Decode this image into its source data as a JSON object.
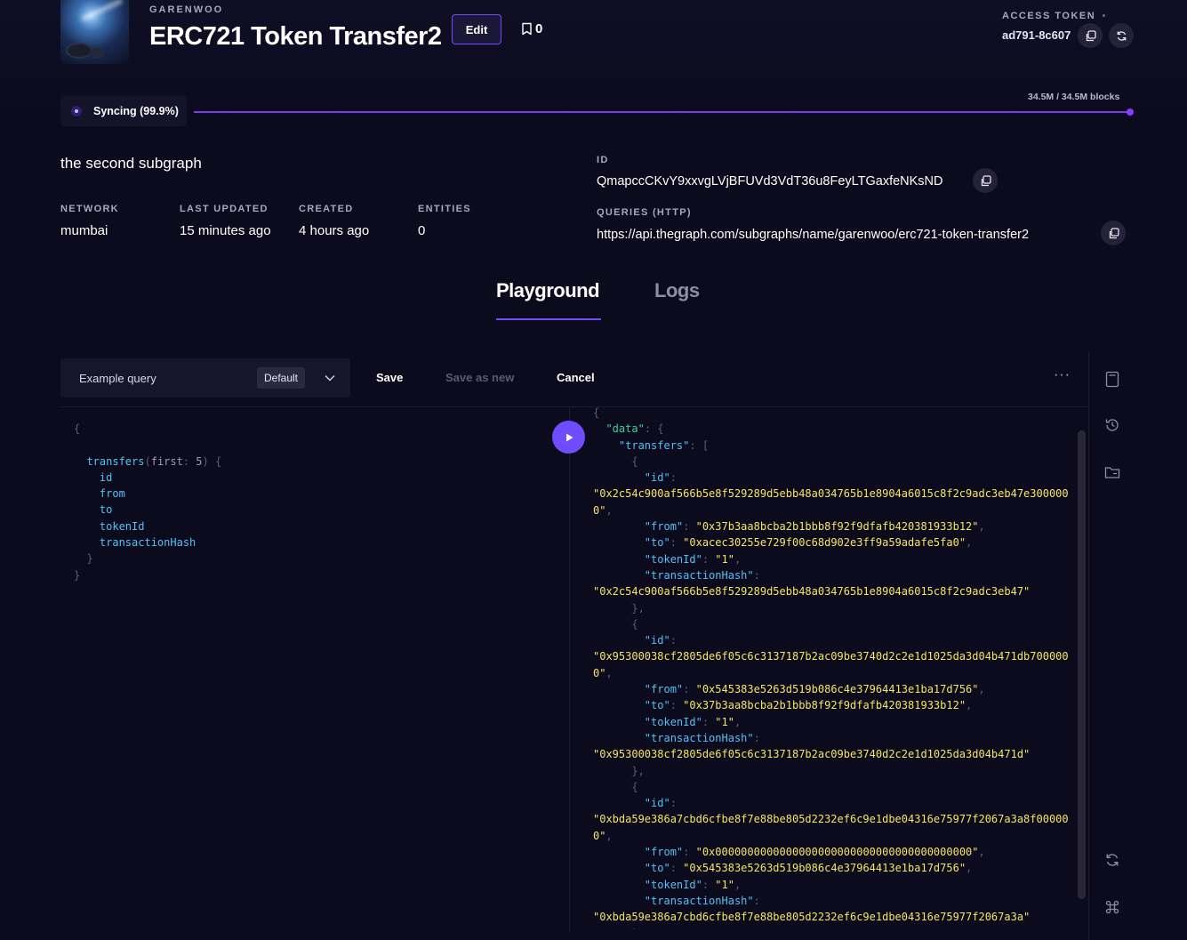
{
  "header": {
    "owner": "GARENWOO",
    "title": "ERC721 Token Transfer2",
    "edit_label": "Edit",
    "bookmark_count": "0",
    "access_token_label": "ACCESS TOKEN",
    "access_token_value": "ad791-8c607"
  },
  "sync": {
    "status": "Syncing (99.9%)",
    "progress_percent": 99.9,
    "blocks": "34.5M / 34.5M blocks",
    "accent": "#7c3aed"
  },
  "details": {
    "description": "the second subgraph",
    "meta": [
      {
        "label": "NETWORK",
        "value": "mumbai"
      },
      {
        "label": "LAST UPDATED",
        "value": "15 minutes ago"
      },
      {
        "label": "CREATED",
        "value": "4 hours ago"
      },
      {
        "label": "ENTITIES",
        "value": "0"
      }
    ],
    "id_label": "ID",
    "id_value": "QmapccCKvY9xxvgLVjBFUVd3VdT36u8FeyLTGaxfeNKsND",
    "queries_label": "QUERIES (HTTP)",
    "queries_value": "https://api.thegraph.com/subgraphs/name/garenwoo/erc721-token-transfer2"
  },
  "tabs": [
    {
      "label": "Playground",
      "active": true
    },
    {
      "label": "Logs",
      "active": false
    }
  ],
  "playground": {
    "query_name": "Example query",
    "default_badge": "Default",
    "save_label": "Save",
    "save_as_new_label": "Save as new",
    "cancel_label": "Cancel",
    "more_label": "···",
    "query_lines": [
      {
        "indent": 0,
        "text": "{",
        "kind": "p"
      },
      {
        "indent": 0,
        "text": "",
        "kind": "p"
      },
      {
        "indent": 1,
        "text": "transfers",
        "kind": "k",
        "suffix_args": "(first: 5) {"
      },
      {
        "indent": 2,
        "text": "id",
        "kind": "k"
      },
      {
        "indent": 2,
        "text": "from",
        "kind": "k"
      },
      {
        "indent": 2,
        "text": "to",
        "kind": "k"
      },
      {
        "indent": 2,
        "text": "tokenId",
        "kind": "k"
      },
      {
        "indent": 2,
        "text": "transactionHash",
        "kind": "k"
      },
      {
        "indent": 1,
        "text": "}",
        "kind": "p"
      },
      {
        "indent": 0,
        "text": "}",
        "kind": "p"
      }
    ],
    "result": {
      "data_key": "\"data\"",
      "transfers_key": "\"transfers\"",
      "transfers": [
        {
          "id": "\"0x2c54c900af566b5e8f529289d5ebb48a034765b1e8904a6015c8f2c9adc3eb47e300000\"",
          "id_wrap": [
            "\"0x2c54c900af566b5e8f529289d5ebb48a034765b1e8904a6015c8f2c9adc3eb47e300000",
            "0\""
          ],
          "from": "\"0x37b3aa8bcba2b1bbb8f92f9dfafb420381933b12\"",
          "to": "\"0xacec30255e729f00c68d902e3ff9a59adafe5fa0\"",
          "tokenId": "\"1\"",
          "transactionHash": "\"0x2c54c900af566b5e8f529289d5ebb48a034765b1e8904a6015c8f2c9adc3eb47\""
        },
        {
          "id": "\"0x95300038cf2805de6f05c6c3137187b2ac09be3740d2c2e1d1025da3d04b471db7000000\"",
          "id_wrap": [
            "\"0x95300038cf2805de6f05c6c3137187b2ac09be3740d2c2e1d1025da3d04b471db700000",
            "0\""
          ],
          "from": "\"0x545383e5263d519b086c4e37964413e1ba17d756\"",
          "to": "\"0x37b3aa8bcba2b1bbb8f92f9dfafb420381933b12\"",
          "tokenId": "\"1\"",
          "transactionHash": "\"0x95300038cf2805de6f05c6c3137187b2ac09be3740d2c2e1d1025da3d04b471d\""
        },
        {
          "id": "\"0xbda59e386a7cbd6cfbe8f7e88be805d2232ef6c9e1dbe04316e75977f2067a3a8f000000\"",
          "id_wrap": [
            "\"0xbda59e386a7cbd6cfbe8f7e88be805d2232ef6c9e1dbe04316e75977f2067a3a8f00000",
            "0\""
          ],
          "from": "\"0x0000000000000000000000000000000000000000\"",
          "to": "\"0x545383e5263d519b086c4e37964413e1ba17d756\"",
          "tokenId": "\"1\"",
          "transactionHash": "\"0xbda59e386a7cbd6cfbe8f7e88be805d2232ef6c9e1dbe04316e75977f2067a3a\""
        }
      ]
    }
  },
  "icons": {
    "bookmark": "bookmark-icon",
    "copy": "copy-icon",
    "refresh": "refresh-icon",
    "chevron": "chevron-down-icon",
    "play": "play-icon",
    "docs": "docs-icon",
    "history": "history-icon",
    "explorer": "folder-icon",
    "prettify": "refresh-icon",
    "shortcuts": "command-icon"
  }
}
